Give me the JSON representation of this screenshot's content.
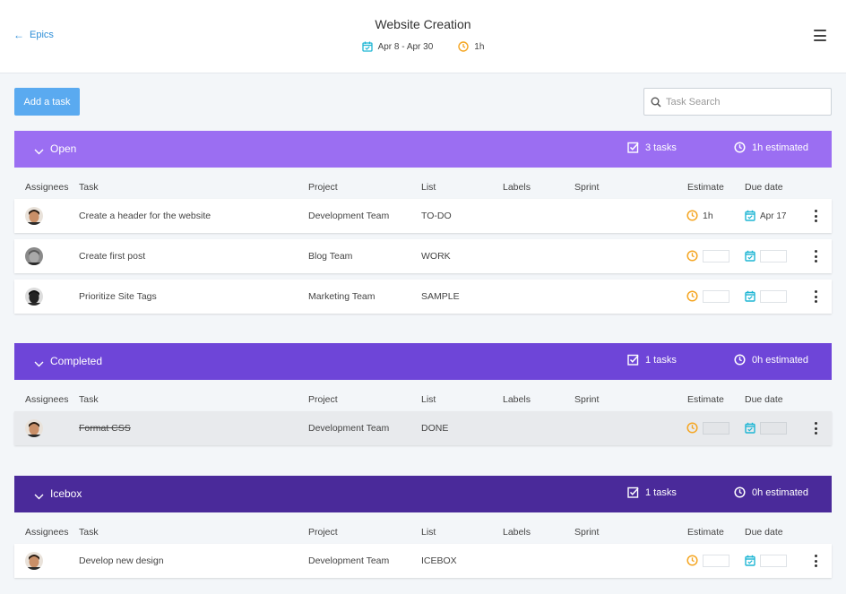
{
  "header": {
    "back_label": "Epics",
    "title": "Website Creation",
    "date_range": "Apr 8 - Apr 30",
    "duration": "1h"
  },
  "toolbar": {
    "add_task_label": "Add a task",
    "search_placeholder": "Task Search"
  },
  "columns": {
    "assignees": "Assignees",
    "task": "Task",
    "project": "Project",
    "list": "List",
    "labels": "Labels",
    "sprint": "Sprint",
    "estimate": "Estimate",
    "due_date": "Due date"
  },
  "sections": [
    {
      "name": "Open",
      "color": "#9b6ef2",
      "tasks_count": "3 tasks",
      "estimated": "1h estimated",
      "rows": [
        {
          "task": "Create a header for the website",
          "project": "Development Team",
          "list": "TO-DO",
          "estimate": "1h",
          "due": "Apr 17"
        },
        {
          "task": "Create first post",
          "project": "Blog Team",
          "list": "WORK",
          "estimate": "",
          "due": ""
        },
        {
          "task": "Prioritize Site Tags",
          "project": "Marketing Team",
          "list": "SAMPLE",
          "estimate": "",
          "due": ""
        }
      ]
    },
    {
      "name": "Completed",
      "color": "#6e45d8",
      "tasks_count": "1 tasks",
      "estimated": "0h estimated",
      "rows": [
        {
          "task": "Format CSS",
          "project": "Development Team",
          "list": "DONE",
          "estimate": "",
          "due": ""
        }
      ]
    },
    {
      "name": "Icebox",
      "color": "#4a2a9a",
      "tasks_count": "1 tasks",
      "estimated": "0h estimated",
      "rows": [
        {
          "task": "Develop new design",
          "project": "Development Team",
          "list": "ICEBOX",
          "estimate": "",
          "due": ""
        }
      ]
    }
  ],
  "colors": {
    "accent_blue": "#2f8fd8",
    "button_blue": "#5aaaf0",
    "estimate_orange": "#f5a623",
    "calendar_teal": "#1fb6d4"
  }
}
